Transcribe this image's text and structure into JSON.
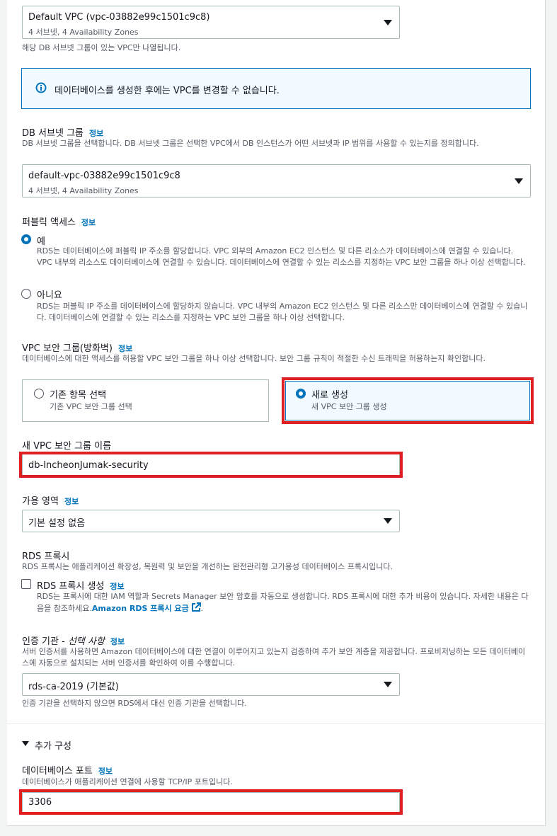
{
  "vpc": {
    "selected_main": "Default VPC (vpc-03882e99c1501c9c8)",
    "selected_sub": "4 서브넷, 4 Availability Zones",
    "helper": "해당 DB 서브넷 그룹이 있는 VPC만 나열됩니다."
  },
  "vpc_alert": {
    "text": "데이터베이스를 생성한 후에는 VPC를 변경할 수 없습니다."
  },
  "subnet_group": {
    "label": "DB 서브넷 그룹",
    "info": "정보",
    "desc": "DB 서브넷 그룹을 선택합니다. DB 서브넷 그룹은 선택한 VPC에서 DB 인스턴스가 어떤 서브넷과 IP 범위를 사용할 수 있는지를 정의합니다.",
    "selected_main": "default-vpc-03882e99c1501c9c8",
    "selected_sub": "4 서브넷, 4 Availability Zones"
  },
  "public_access": {
    "label": "퍼블릭 액세스",
    "info": "정보",
    "yes_label": "예",
    "yes_desc": "RDS는 데이터베이스에 퍼블릭 IP 주소를 할당합니다. VPC 외부의 Amazon EC2 인스턴스 및 다른 리소스가 데이터베이스에 연결할 수 있습니다. VPC 내부의 리소스도 데이터베이스에 연결할 수 있습니다. 데이터베이스에 연결할 수 있는 리소스를 지정하는 VPC 보안 그룹을 하나 이상 선택합니다.",
    "no_label": "아니요",
    "no_desc": "RDS는 퍼블릭 IP 주소를 데이터베이스에 할당하지 않습니다. VPC 내부의 Amazon EC2 인스턴스 및 다른 리소스만 데이터베이스에 연결할 수 있습니다. 데이터베이스에 연결할 수 있는 리소스를 지정하는 VPC 보안 그룹을 하나 이상 선택합니다."
  },
  "security_group": {
    "label": "VPC 보안 그룹(방화벽)",
    "info": "정보",
    "desc": "데이터베이스에 대한 액세스를 허용할 VPC 보안 그룹을 하나 이상 선택합니다. 보안 그룹 규칙이 적절한 수신 트래픽을 허용하는지 확인합니다.",
    "existing_title": "기존 항목 선택",
    "existing_sub": "기존 VPC 보안 그룹 선택",
    "new_title": "새로 생성",
    "new_sub": "새 VPC 보안 그룹 생성"
  },
  "new_sg_name": {
    "label": "새 VPC 보안 그룹 이름",
    "value": "db-IncheonJumak-security"
  },
  "availability_zone": {
    "label": "가용 영역",
    "info": "정보",
    "selected": "기본 설정 없음"
  },
  "rds_proxy": {
    "label": "RDS 프록시",
    "desc": "RDS 프록시는 애플리케이션 확장성, 복원력 및 보안을 개선하는 완전관리형 고가용성 데이터베이스 프록시입니다.",
    "checkbox_label": "RDS 프록시 생성",
    "info": "정보",
    "checkbox_desc": "RDS는 프록시에 대한 IAM 역할과 Secrets Manager 보안 암호를 자동으로 생성합니다. RDS 프록시에 대한 추가 비용이 있습니다. 자세한 내용은 다음을 참조하세요.",
    "pricing_link": "Amazon RDS 프록시 요금"
  },
  "cert_authority": {
    "label_main": "인증 기관 - ",
    "label_optional": "선택 사항",
    "info": "정보",
    "desc": "서버 인증서를 사용하면 Amazon 데이터베이스에 대한 연결이 이루어지고 있는지 검증하여 추가 보안 계층을 제공합니다. 프로비저닝하는 모든 데이터베이스에 자동으로 설치되는 서버 인증서를 확인하여 이를 수행합니다.",
    "selected": "rds-ca-2019 (기본값)",
    "helper": "인증 기관을 선택하지 않으면 RDS에서 대신 인증 기관을 선택합니다."
  },
  "additional": {
    "toggle_label": "추가 구성",
    "port_label": "데이터베이스 포트",
    "info": "정보",
    "port_desc": "데이터베이스가 애플리케이션 연결에 사용할 TCP/IP 포트입니다.",
    "port_value": "3306"
  },
  "colors": {
    "accent": "#0073bb",
    "highlight_border": "#e02020",
    "alert_bg": "#f1faff"
  }
}
